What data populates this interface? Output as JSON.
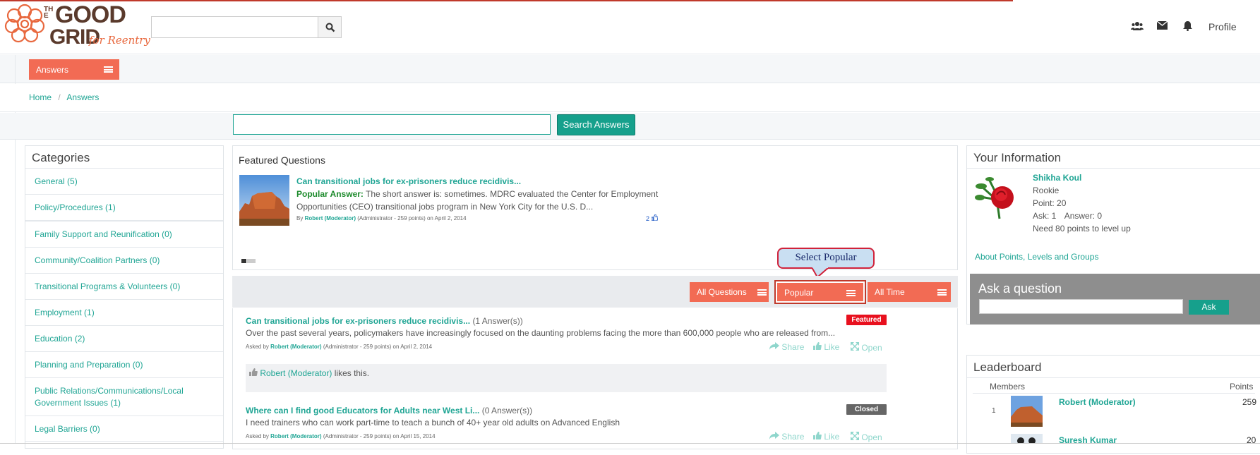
{
  "header": {
    "logo": {
      "the": "THE",
      "good": "GOOD",
      "grid": "GRID",
      "tagline": "for Reentry"
    },
    "search_placeholder": "",
    "icons": [
      "users-icon",
      "envelope-icon",
      "bell-icon"
    ],
    "profile_label": "Profile"
  },
  "nav": {
    "answers_label": "Answers"
  },
  "breadcrumb": {
    "home": "Home",
    "separator": "/",
    "current": "Answers"
  },
  "search_answers": {
    "placeholder": "",
    "button": "Search Answers"
  },
  "categories": {
    "title": "Categories",
    "items": [
      {
        "label": "General (5)"
      },
      {
        "label": "Policy/Procedures (1)"
      },
      {
        "label": "Family Support and Reunification (0)"
      },
      {
        "label": "Community/Coalition Partners (0)"
      },
      {
        "label": "Transitional Programs & Volunteers (0)"
      },
      {
        "label": "Employment (1)"
      },
      {
        "label": "Education (2)"
      },
      {
        "label": "Planning and Preparation (0)"
      },
      {
        "label": "Public Relations/Communications/Local Government Issues (1)"
      },
      {
        "label": "Legal Barriers (0)"
      }
    ]
  },
  "featured": {
    "title": "Featured Questions",
    "question": "Can transitional jobs for ex-prisoners reduce recidivis...",
    "popular_label": "Popular Answer:",
    "answer_line1": "The short answer is: sometimes. MDRC evaluated the Center for Employment",
    "answer_line2": "Opportunities (CEO) transitional jobs program in New York City for the U.S. D...",
    "by_prefix": "By",
    "author": "Robert (Moderator)",
    "author_meta": "(Administrator - 259 points)",
    "date": "on April 2, 2014",
    "likes": "2"
  },
  "callout": "Select Popular",
  "tabs": {
    "all_questions": "All Questions",
    "popular": "Popular",
    "all_time": "All Time"
  },
  "questions": [
    {
      "title": "Can transitional jobs for ex-prisoners reduce recidivis...",
      "answers": "(1 Answer(s))",
      "excerpt": "Over the past several years, policymakers have increasingly focused on the daunting problems facing the more than 600,000 people who are released from...",
      "asked_by": "Asked by",
      "author": "Robert (Moderator)",
      "meta": "(Administrator - 259 points) on April 2, 2014",
      "badge": "Featured",
      "badge_color": "#e8101e",
      "likes_text": "likes this.",
      "liker": "Robert (Moderator)"
    },
    {
      "title": "Where can I find good Educators for Adults near West Li...",
      "answers": "(0 Answer(s))",
      "excerpt": "I need trainers who can work part-time to teach a bunch of 40+ year old adults on Advanced English",
      "asked_by": "Asked by",
      "author": "Robert (Moderator)",
      "meta": "(Administrator - 259 points) on April 15, 2014",
      "badge": "Closed",
      "badge_color": "#666666"
    }
  ],
  "actions": {
    "share": "Share",
    "like": "Like",
    "open": "Open"
  },
  "your_info": {
    "title": "Your Information",
    "name": "Shikha Koul",
    "rank": "Rookie",
    "points": "Point: 20",
    "ask": "Ask: 1",
    "answer": "Answer: 0",
    "need": "Need 80 points to level up",
    "about_link": "About Points, Levels and Groups"
  },
  "ask_question": {
    "title": "Ask a question",
    "placeholder": "",
    "button": "Ask"
  },
  "leaderboard": {
    "title": "Leaderboard",
    "col_members": "Members",
    "col_points": "Points",
    "rows": [
      {
        "rank": "1",
        "name": "Robert (Moderator)",
        "points": "259"
      },
      {
        "rank": "",
        "name": "Suresh Kumar",
        "points": "20"
      }
    ]
  },
  "colors": {
    "accent": "#f26b54",
    "teal": "#1fa594",
    "button_teal": "#16a08c"
  }
}
